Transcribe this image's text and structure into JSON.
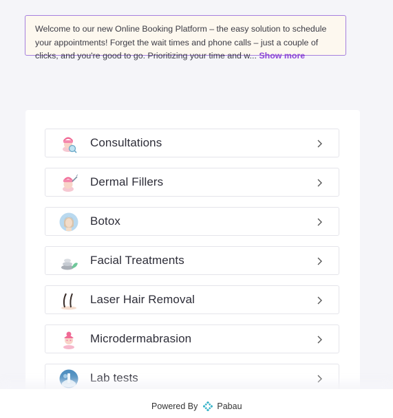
{
  "banner": {
    "text": "Welcome to our new Online Booking Platform – the easy solution to schedule your appointments! Forget the wait times and phone calls – just a couple of clicks, and you're good to go. Prioritizing your time and w...",
    "show_more_label": "Show more"
  },
  "categories": [
    {
      "label": "Consultations",
      "icon": "consultation-icon"
    },
    {
      "label": "Dermal Fillers",
      "icon": "dermal-fillers-icon"
    },
    {
      "label": "Botox",
      "icon": "botox-icon"
    },
    {
      "label": "Facial Treatments",
      "icon": "facial-treatments-icon"
    },
    {
      "label": "Laser Hair Removal",
      "icon": "laser-hair-removal-icon"
    },
    {
      "label": "Microdermabrasion",
      "icon": "microdermabrasion-icon"
    },
    {
      "label": "Lab tests",
      "icon": "lab-tests-icon"
    }
  ],
  "footer": {
    "powered_by": "Powered By",
    "brand": "Pabau"
  },
  "colors": {
    "accent": "#8d46d6",
    "banner_border": "#a57fde",
    "banner_bg": "#fdf8ef"
  }
}
